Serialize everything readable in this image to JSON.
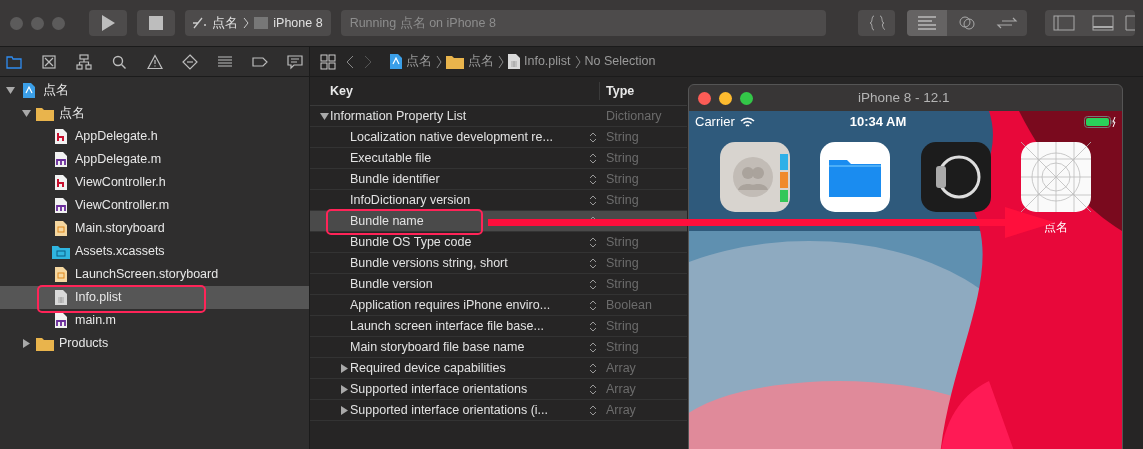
{
  "toolbar": {
    "scheme": "点名",
    "device": "iPhone 8",
    "activity": "Running 点名 on iPhone 8",
    "editor_modes": [
      {
        "kind": "standard",
        "selected": true
      },
      {
        "kind": "assistant",
        "selected": false
      },
      {
        "kind": "version",
        "selected": false
      }
    ]
  },
  "navigator_tabs": [
    {
      "kind": "project",
      "selected": true
    },
    {
      "kind": "source",
      "selected": false
    },
    {
      "kind": "symbol",
      "selected": false
    },
    {
      "kind": "find",
      "selected": false
    },
    {
      "kind": "issue",
      "selected": false
    },
    {
      "kind": "test",
      "selected": false
    },
    {
      "kind": "debug",
      "selected": false
    },
    {
      "kind": "breakpoint",
      "selected": false
    },
    {
      "kind": "report",
      "selected": false
    }
  ],
  "jump_bar": {
    "path": [
      {
        "kind": "project",
        "label": "点名"
      },
      {
        "kind": "folder",
        "label": "点名"
      },
      {
        "kind": "plist",
        "label": "Info.plist"
      }
    ],
    "selection": "No Selection"
  },
  "navigator": [
    {
      "kind": "project",
      "label": "点名",
      "expanded": true,
      "selected": false,
      "children": [
        {
          "kind": "folder",
          "label": "点名",
          "expanded": true,
          "selected": false,
          "children": [
            {
              "kind": "h",
              "label": "AppDelegate.h",
              "selected": false
            },
            {
              "kind": "m",
              "label": "AppDelegate.m",
              "selected": false
            },
            {
              "kind": "h",
              "label": "ViewController.h",
              "selected": false
            },
            {
              "kind": "m",
              "label": "ViewController.m",
              "selected": false
            },
            {
              "kind": "storyboard",
              "label": "Main.storyboard",
              "selected": false
            },
            {
              "kind": "xcassets",
              "label": "Assets.xcassets",
              "selected": false
            },
            {
              "kind": "storyboard",
              "label": "LaunchScreen.storyboard",
              "selected": false
            },
            {
              "kind": "plist",
              "label": "Info.plist",
              "selected": true
            },
            {
              "kind": "m",
              "label": "main.m",
              "selected": false
            }
          ]
        },
        {
          "kind": "folder",
          "label": "Products",
          "expanded": false,
          "selected": false
        }
      ]
    }
  ],
  "plist": {
    "columns": [
      "Key",
      "Type"
    ],
    "rows": [
      {
        "key": "Information Property List",
        "type": "Dictionary",
        "expanded": true,
        "selected": false,
        "children": [
          {
            "key": "Localization native development re...",
            "type": "String",
            "selected": false
          },
          {
            "key": "Executable file",
            "type": "String",
            "selected": false
          },
          {
            "key": "Bundle identifier",
            "type": "String",
            "selected": false
          },
          {
            "key": "InfoDictionary version",
            "type": "String",
            "selected": false
          },
          {
            "key": "Bundle name",
            "selected": true
          },
          {
            "key": "Bundle OS Type code",
            "type": "String",
            "selected": false
          },
          {
            "key": "Bundle versions string, short",
            "type": "String",
            "selected": false
          },
          {
            "key": "Bundle version",
            "type": "String",
            "selected": false
          },
          {
            "key": "Application requires iPhone enviro...",
            "type": "Boolean",
            "selected": false
          },
          {
            "key": "Launch screen interface file base...",
            "type": "String",
            "selected": false
          },
          {
            "key": "Main storyboard file base name",
            "type": "String",
            "selected": false
          },
          {
            "key": "Required device capabilities",
            "type": "Array",
            "expanded": false,
            "selected": false
          },
          {
            "key": "Supported interface orientations",
            "type": "Array",
            "expanded": false,
            "selected": false
          },
          {
            "key": "Supported interface orientations (i...",
            "type": "Array",
            "expanded": false,
            "selected": false
          }
        ]
      }
    ]
  },
  "simulator": {
    "title": "iPhone 8 - 12.1",
    "carrier": "Carrier",
    "time": "10:34 AM",
    "apps": [
      {
        "kind": "contacts"
      },
      {
        "kind": "files"
      },
      {
        "kind": "watch"
      },
      {
        "kind": "placeholder",
        "label": "点名"
      }
    ]
  }
}
